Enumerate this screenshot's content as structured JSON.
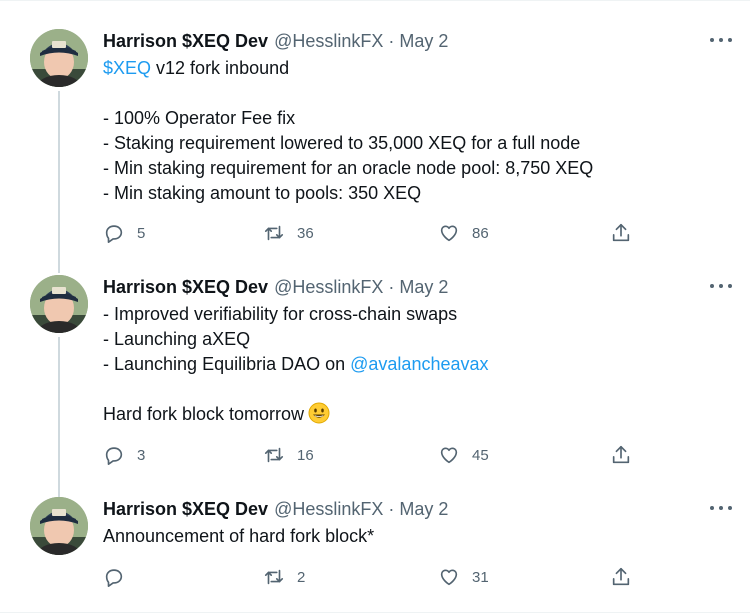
{
  "tweets": [
    {
      "author": "Harrison $XEQ Dev",
      "handle": "@HesslinkFX",
      "separator": "·",
      "date": "May 2",
      "lines": [
        {
          "parts": [
            {
              "text": "$XEQ",
              "link": true
            },
            {
              "text": " v12 fork inbound",
              "link": false
            }
          ]
        },
        {
          "parts": []
        },
        {
          "parts": [
            {
              "text": "- 100% Operator Fee fix",
              "link": false
            }
          ]
        },
        {
          "parts": [
            {
              "text": "- Staking requirement lowered to 35,000 XEQ for a full node",
              "link": false
            }
          ]
        },
        {
          "parts": [
            {
              "text": "- Min staking requirement for an oracle node pool: 8,750 XEQ",
              "link": false
            }
          ]
        },
        {
          "parts": [
            {
              "text": "- Min staking amount to pools: 350 XEQ",
              "link": false
            }
          ]
        }
      ],
      "reply_count": "5",
      "retweet_count": "36",
      "like_count": "86"
    },
    {
      "author": "Harrison $XEQ Dev",
      "handle": "@HesslinkFX",
      "separator": "·",
      "date": "May 2",
      "lines": [
        {
          "parts": [
            {
              "text": "- Improved verifiability for cross-chain swaps",
              "link": false
            }
          ]
        },
        {
          "parts": [
            {
              "text": "- Launching aXEQ",
              "link": false
            }
          ]
        },
        {
          "parts": [
            {
              "text": "- Launching Equilibria DAO on ",
              "link": false
            },
            {
              "text": "@avalancheavax",
              "link": true
            }
          ]
        },
        {
          "parts": []
        },
        {
          "parts": [
            {
              "text": "Hard fork block tomorrow",
              "link": false
            }
          ],
          "emoji": "grinning-face-emoji"
        }
      ],
      "reply_count": "3",
      "retweet_count": "16",
      "like_count": "45"
    },
    {
      "author": "Harrison $XEQ Dev",
      "handle": "@HesslinkFX",
      "separator": "·",
      "date": "May 2",
      "lines": [
        {
          "parts": [
            {
              "text": "Announcement of hard fork block*",
              "link": false
            }
          ]
        }
      ],
      "reply_count": "",
      "retweet_count": "2",
      "like_count": "31"
    }
  ],
  "icons": {
    "reply": "reply-icon",
    "retweet": "retweet-icon",
    "like": "heart-icon",
    "share": "share-icon",
    "more": "more-options-icon"
  },
  "colors": {
    "link": "#1d9bf0",
    "text": "#0f1419",
    "secondary": "#536471",
    "thread_line": "#cfd9de"
  }
}
